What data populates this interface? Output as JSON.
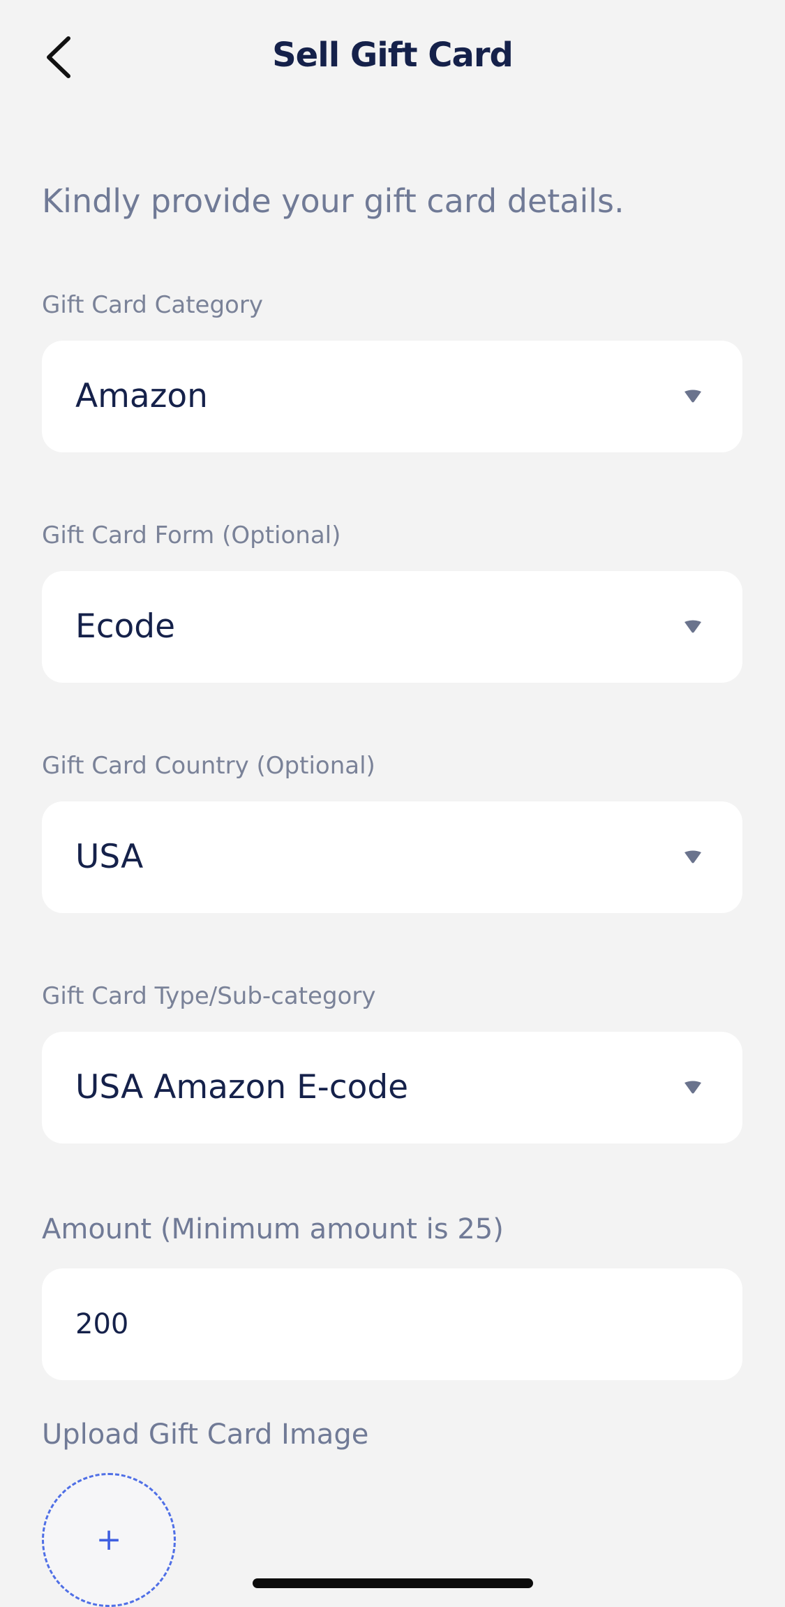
{
  "header": {
    "title": "Sell Gift Card",
    "back_icon": "chevron-left-icon"
  },
  "subtitle": "Kindly provide your gift card details.",
  "fields": {
    "category": {
      "label": "Gift Card Category",
      "value": "Amazon"
    },
    "form": {
      "label": "Gift Card Form (Optional)",
      "value": "Ecode"
    },
    "country": {
      "label": "Gift Card Country (Optional)",
      "value": "USA"
    },
    "type": {
      "label": "Gift Card Type/Sub-category",
      "value": "USA Amazon E-code"
    },
    "amount": {
      "label": "Amount (Minimum amount is 25)",
      "value": "200"
    }
  },
  "upload": {
    "label": "Upload Gift Card Image",
    "icon": "plus-icon",
    "symbol": "+"
  },
  "colors": {
    "background": "#f3f3f3",
    "title": "#15214a",
    "muted_text": "#707a96",
    "accent": "#4f6fe6",
    "field_bg": "#ffffff"
  }
}
